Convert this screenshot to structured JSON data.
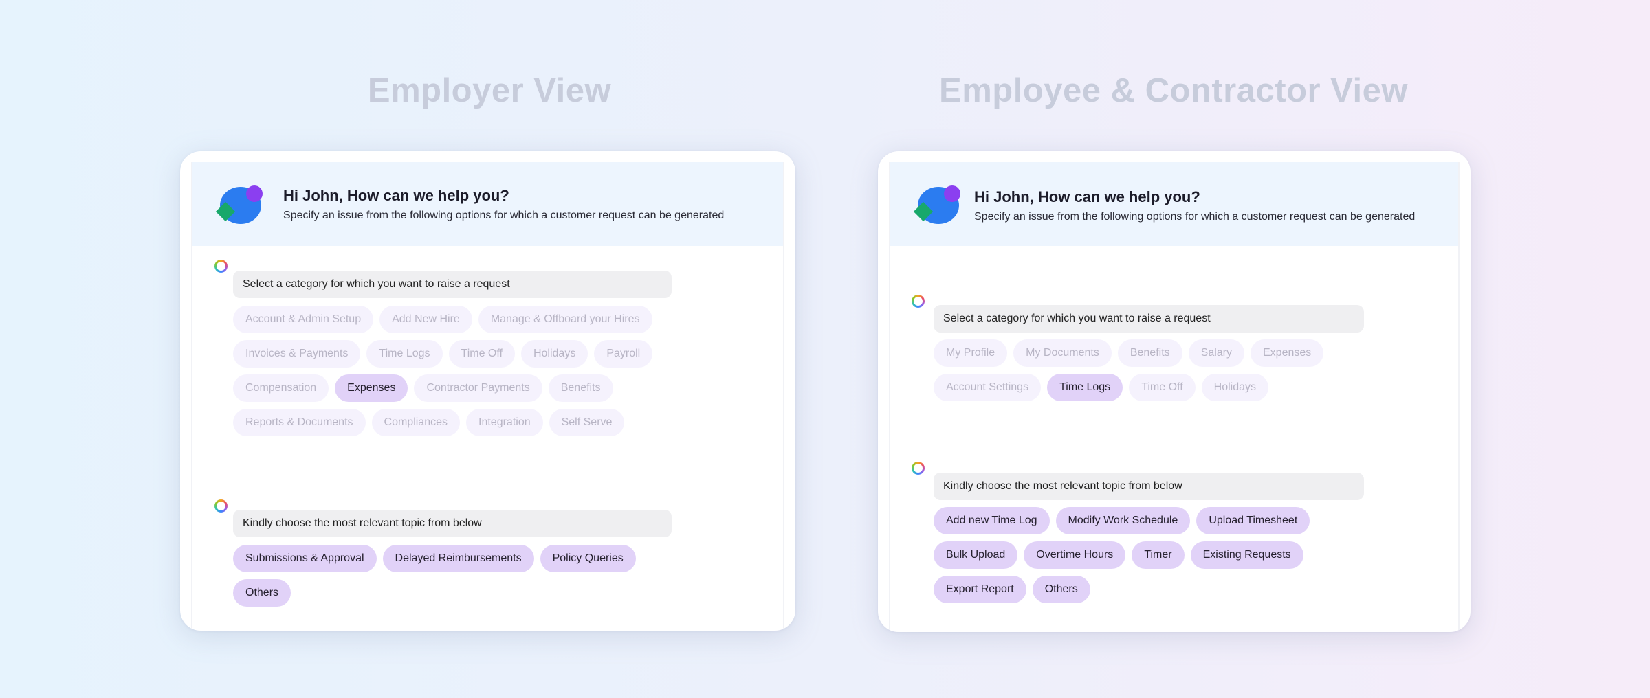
{
  "employer": {
    "title": "Employer View",
    "greeting": "Hi John, How can we help you?",
    "subtitle": "Specify an issue from the following options for which a customer request can be generated",
    "category_prompt": "Select a category for which you want to raise a request",
    "categories": [
      [
        "Account & Admin Setup",
        "Add New Hire",
        "Manage & Offboard your Hires"
      ],
      [
        "Invoices & Payments",
        "Time Logs",
        "Time Off",
        "Holidays",
        "Payroll"
      ],
      [
        "Compensation",
        "Expenses",
        "Contractor Payments",
        "Benefits"
      ],
      [
        "Reports & Documents",
        "Compliances",
        "Integration",
        "Self Serve"
      ]
    ],
    "selected_category": "Expenses",
    "topic_prompt": "Kindly choose the most relevant topic from below",
    "topics": [
      [
        "Submissions & Approval",
        "Delayed Reimbursements",
        "Policy Queries"
      ],
      [
        "Others"
      ]
    ]
  },
  "employee": {
    "title": "Employee & Contractor View",
    "greeting": "Hi John, How can we help you?",
    "subtitle": "Specify an issue from the following options for which a customer request can be generated",
    "category_prompt": "Select a category for which you want to raise a request",
    "categories": [
      [
        "My Profile",
        "My Documents",
        "Benefits",
        "Salary",
        "Expenses"
      ],
      [
        "Account Settings",
        "Time Logs",
        "Time Off",
        "Holidays"
      ]
    ],
    "selected_category": "Time Logs",
    "topic_prompt": "Kindly choose the most relevant topic from below",
    "topics": [
      [
        "Add new Time Log",
        "Modify Work Schedule",
        "Upload Timesheet"
      ],
      [
        "Bulk Upload",
        "Overtime Hours",
        "Timer",
        "Existing Requests"
      ],
      [
        "Export Report",
        "Others"
      ]
    ]
  },
  "icons": {
    "assistant_logo": "assistant-logo-icon",
    "bot_avatar": "bot-avatar-icon"
  },
  "colors": {
    "chip_selected": "#e1d2f8",
    "chip_unselected": "#f5f2fd",
    "header_bg": "#edf5fe",
    "logo_blue": "#2b7cf0",
    "logo_purple": "#8b3ff0",
    "logo_green": "#18a86b"
  }
}
